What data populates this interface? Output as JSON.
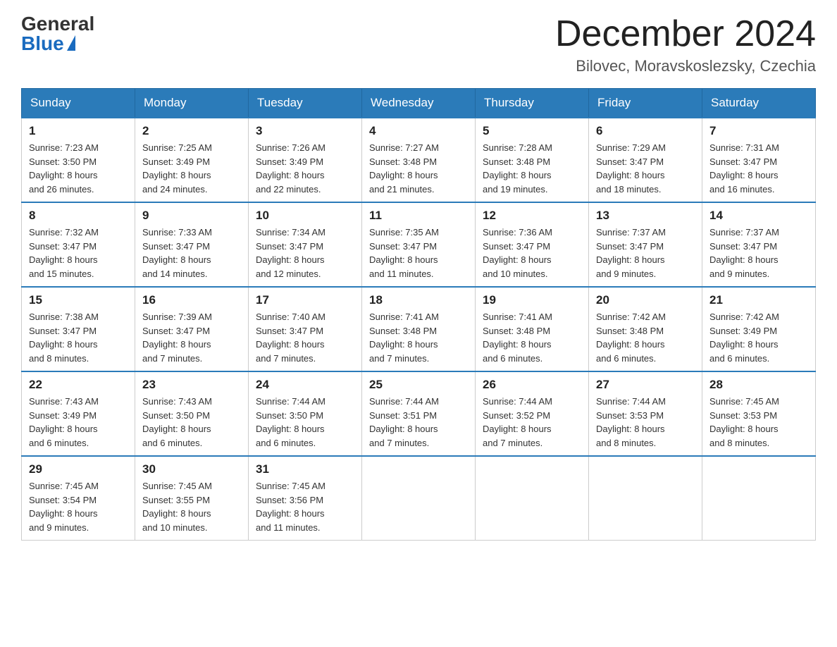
{
  "header": {
    "logo_general": "General",
    "logo_blue": "Blue",
    "month_title": "December 2024",
    "location": "Bilovec, Moravskoslezsky, Czechia"
  },
  "weekdays": [
    "Sunday",
    "Monday",
    "Tuesday",
    "Wednesday",
    "Thursday",
    "Friday",
    "Saturday"
  ],
  "weeks": [
    [
      {
        "day": "1",
        "sunrise": "7:23 AM",
        "sunset": "3:50 PM",
        "daylight": "8 hours and 26 minutes."
      },
      {
        "day": "2",
        "sunrise": "7:25 AM",
        "sunset": "3:49 PM",
        "daylight": "8 hours and 24 minutes."
      },
      {
        "day": "3",
        "sunrise": "7:26 AM",
        "sunset": "3:49 PM",
        "daylight": "8 hours and 22 minutes."
      },
      {
        "day": "4",
        "sunrise": "7:27 AM",
        "sunset": "3:48 PM",
        "daylight": "8 hours and 21 minutes."
      },
      {
        "day": "5",
        "sunrise": "7:28 AM",
        "sunset": "3:48 PM",
        "daylight": "8 hours and 19 minutes."
      },
      {
        "day": "6",
        "sunrise": "7:29 AM",
        "sunset": "3:47 PM",
        "daylight": "8 hours and 18 minutes."
      },
      {
        "day": "7",
        "sunrise": "7:31 AM",
        "sunset": "3:47 PM",
        "daylight": "8 hours and 16 minutes."
      }
    ],
    [
      {
        "day": "8",
        "sunrise": "7:32 AM",
        "sunset": "3:47 PM",
        "daylight": "8 hours and 15 minutes."
      },
      {
        "day": "9",
        "sunrise": "7:33 AM",
        "sunset": "3:47 PM",
        "daylight": "8 hours and 14 minutes."
      },
      {
        "day": "10",
        "sunrise": "7:34 AM",
        "sunset": "3:47 PM",
        "daylight": "8 hours and 12 minutes."
      },
      {
        "day": "11",
        "sunrise": "7:35 AM",
        "sunset": "3:47 PM",
        "daylight": "8 hours and 11 minutes."
      },
      {
        "day": "12",
        "sunrise": "7:36 AM",
        "sunset": "3:47 PM",
        "daylight": "8 hours and 10 minutes."
      },
      {
        "day": "13",
        "sunrise": "7:37 AM",
        "sunset": "3:47 PM",
        "daylight": "8 hours and 9 minutes."
      },
      {
        "day": "14",
        "sunrise": "7:37 AM",
        "sunset": "3:47 PM",
        "daylight": "8 hours and 9 minutes."
      }
    ],
    [
      {
        "day": "15",
        "sunrise": "7:38 AM",
        "sunset": "3:47 PM",
        "daylight": "8 hours and 8 minutes."
      },
      {
        "day": "16",
        "sunrise": "7:39 AM",
        "sunset": "3:47 PM",
        "daylight": "8 hours and 7 minutes."
      },
      {
        "day": "17",
        "sunrise": "7:40 AM",
        "sunset": "3:47 PM",
        "daylight": "8 hours and 7 minutes."
      },
      {
        "day": "18",
        "sunrise": "7:41 AM",
        "sunset": "3:48 PM",
        "daylight": "8 hours and 7 minutes."
      },
      {
        "day": "19",
        "sunrise": "7:41 AM",
        "sunset": "3:48 PM",
        "daylight": "8 hours and 6 minutes."
      },
      {
        "day": "20",
        "sunrise": "7:42 AM",
        "sunset": "3:48 PM",
        "daylight": "8 hours and 6 minutes."
      },
      {
        "day": "21",
        "sunrise": "7:42 AM",
        "sunset": "3:49 PM",
        "daylight": "8 hours and 6 minutes."
      }
    ],
    [
      {
        "day": "22",
        "sunrise": "7:43 AM",
        "sunset": "3:49 PM",
        "daylight": "8 hours and 6 minutes."
      },
      {
        "day": "23",
        "sunrise": "7:43 AM",
        "sunset": "3:50 PM",
        "daylight": "8 hours and 6 minutes."
      },
      {
        "day": "24",
        "sunrise": "7:44 AM",
        "sunset": "3:50 PM",
        "daylight": "8 hours and 6 minutes."
      },
      {
        "day": "25",
        "sunrise": "7:44 AM",
        "sunset": "3:51 PM",
        "daylight": "8 hours and 7 minutes."
      },
      {
        "day": "26",
        "sunrise": "7:44 AM",
        "sunset": "3:52 PM",
        "daylight": "8 hours and 7 minutes."
      },
      {
        "day": "27",
        "sunrise": "7:44 AM",
        "sunset": "3:53 PM",
        "daylight": "8 hours and 8 minutes."
      },
      {
        "day": "28",
        "sunrise": "7:45 AM",
        "sunset": "3:53 PM",
        "daylight": "8 hours and 8 minutes."
      }
    ],
    [
      {
        "day": "29",
        "sunrise": "7:45 AM",
        "sunset": "3:54 PM",
        "daylight": "8 hours and 9 minutes."
      },
      {
        "day": "30",
        "sunrise": "7:45 AM",
        "sunset": "3:55 PM",
        "daylight": "8 hours and 10 minutes."
      },
      {
        "day": "31",
        "sunrise": "7:45 AM",
        "sunset": "3:56 PM",
        "daylight": "8 hours and 11 minutes."
      },
      null,
      null,
      null,
      null
    ]
  ],
  "labels": {
    "sunrise": "Sunrise:",
    "sunset": "Sunset:",
    "daylight": "Daylight:"
  }
}
